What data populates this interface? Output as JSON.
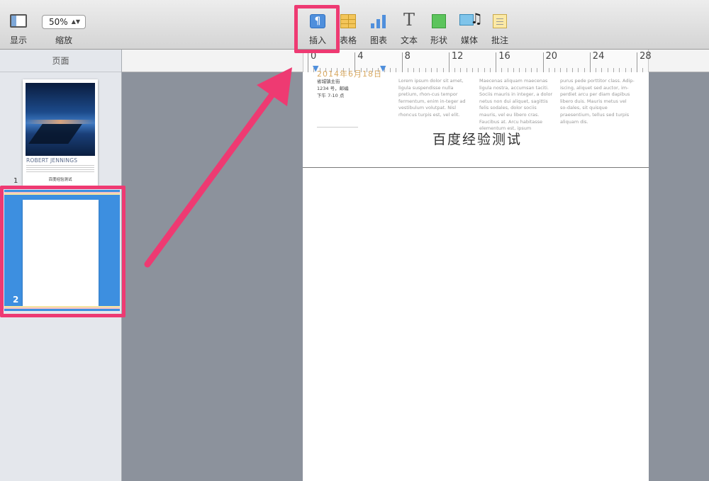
{
  "toolbar": {
    "view_label": "显示",
    "zoom_label": "缩放",
    "zoom_value": "50%",
    "insert_label": "插入",
    "table_label": "表格",
    "chart_label": "图表",
    "text_label": "文本",
    "shape_label": "形状",
    "media_label": "媒体",
    "comment_label": "批注"
  },
  "sidebar": {
    "header": "页面",
    "pages": [
      {
        "number": "1",
        "thumb_name": "ROBERT JENNINGS",
        "thumb_title": "百度经验测试"
      },
      {
        "number": "2"
      }
    ]
  },
  "ruler": {
    "labels": [
      "0",
      "4",
      "8",
      "12",
      "16",
      "20",
      "24",
      "28"
    ]
  },
  "document": {
    "date": "2014年6月18日",
    "address_lines": [
      "省城镇主街",
      "1234 号，邮编",
      "下午 7-10 点"
    ],
    "columns": [
      "Lorem ipsum dolor sit amet, ligula suspendisse nulla pretium, rhon-cus tempor fermentum, enim in-teger ad vestibulum volutpat. Nisl rhoncus turpis est, vel elit.",
      "Maecenas aliquam maecenas ligula nostra, accumsan taciti. Sociis mauris in integer, a dolor netus non dui aliquet, sagittis felis sodales, dolor sociis mauris, vel eu libero cras. Faucibus at. Arcu habitasse elementum est, ipsum",
      "purus pede porttitor class. Adip-iscing, aliquet sed auctor, im-perdiet arcu per diam dapibus libero duis. Mauris metus vel so-dales, sit quisque praesentium, tellus sed turpis aliquam dis."
    ],
    "title": "百度经验测试"
  },
  "colors": {
    "highlight": "#ee3a72",
    "selection": "#3d8fe0",
    "accent_blue": "#4f8fdc"
  }
}
